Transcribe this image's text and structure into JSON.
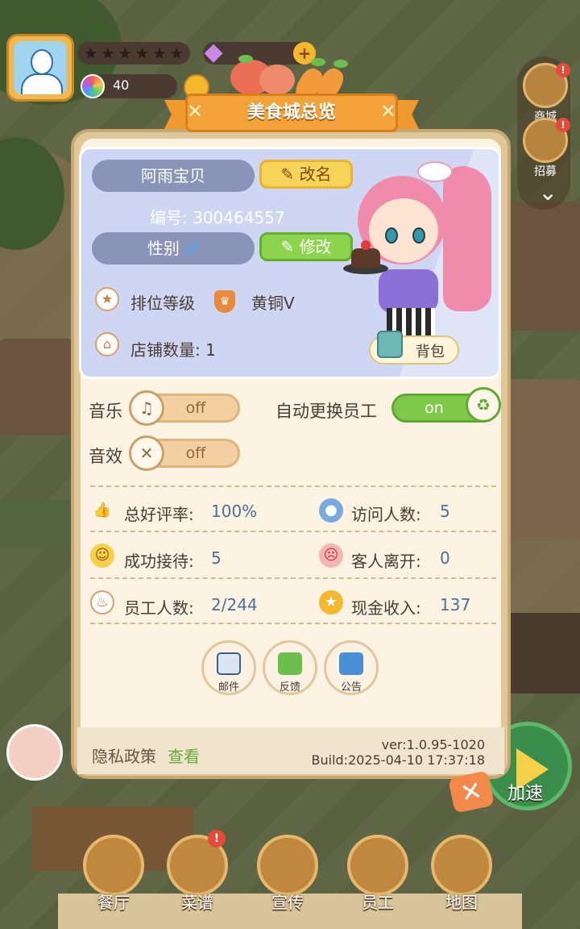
{
  "hud": {
    "coin_value": "40",
    "stars_filled": 0,
    "stars_total": 6
  },
  "side": {
    "shop_label": "商城",
    "recruit_label": "招募"
  },
  "panel": {
    "title": "美食城总览",
    "player_name": "阿雨宝贝",
    "rename_label": "改名",
    "id_text": "编号: 300464557",
    "gender_label": "性别",
    "gender_symbol": "♂",
    "modify_label": "修改",
    "rank_label": "排位等级",
    "rank_value": "黄铜V",
    "stores_text": "店铺数量: 1",
    "bag_label": "背包"
  },
  "settings": {
    "music_label": "音乐",
    "music_state": "off",
    "sfx_label": "音效",
    "sfx_state": "off",
    "auto_staff_label": "自动更换员工",
    "auto_staff_state": "on"
  },
  "stats": {
    "rating_label": "总好评率:",
    "rating_value": "100%",
    "visitors_label": "访问人数:",
    "visitors_value": "5",
    "served_label": "成功接待:",
    "served_value": "5",
    "left_label": "客人离开:",
    "left_value": "0",
    "staff_label": "员工人数:",
    "staff_value": "2/244",
    "cash_label": "现金收入:",
    "cash_value": "137"
  },
  "actions": {
    "mail_label": "邮件",
    "feedback_label": "反馈",
    "notice_label": "公告"
  },
  "footer": {
    "privacy_label": "隐私政策",
    "view_label": "查看",
    "version": "ver:1.0.95-1020",
    "build": "Build:2025-04-10 17:37:18"
  },
  "speed_label": "加速",
  "nav": {
    "restaurant": "餐厅",
    "recipes": "菜谱",
    "promote": "宣传",
    "staff": "员工",
    "map": "地图"
  },
  "colors": {
    "panel_bg": "#fdf3e3",
    "ribbon": "#f3a23a",
    "toggle_on": "#7fc94a",
    "toggle_off": "#f2d0a2",
    "value_text": "#4c6f99"
  }
}
